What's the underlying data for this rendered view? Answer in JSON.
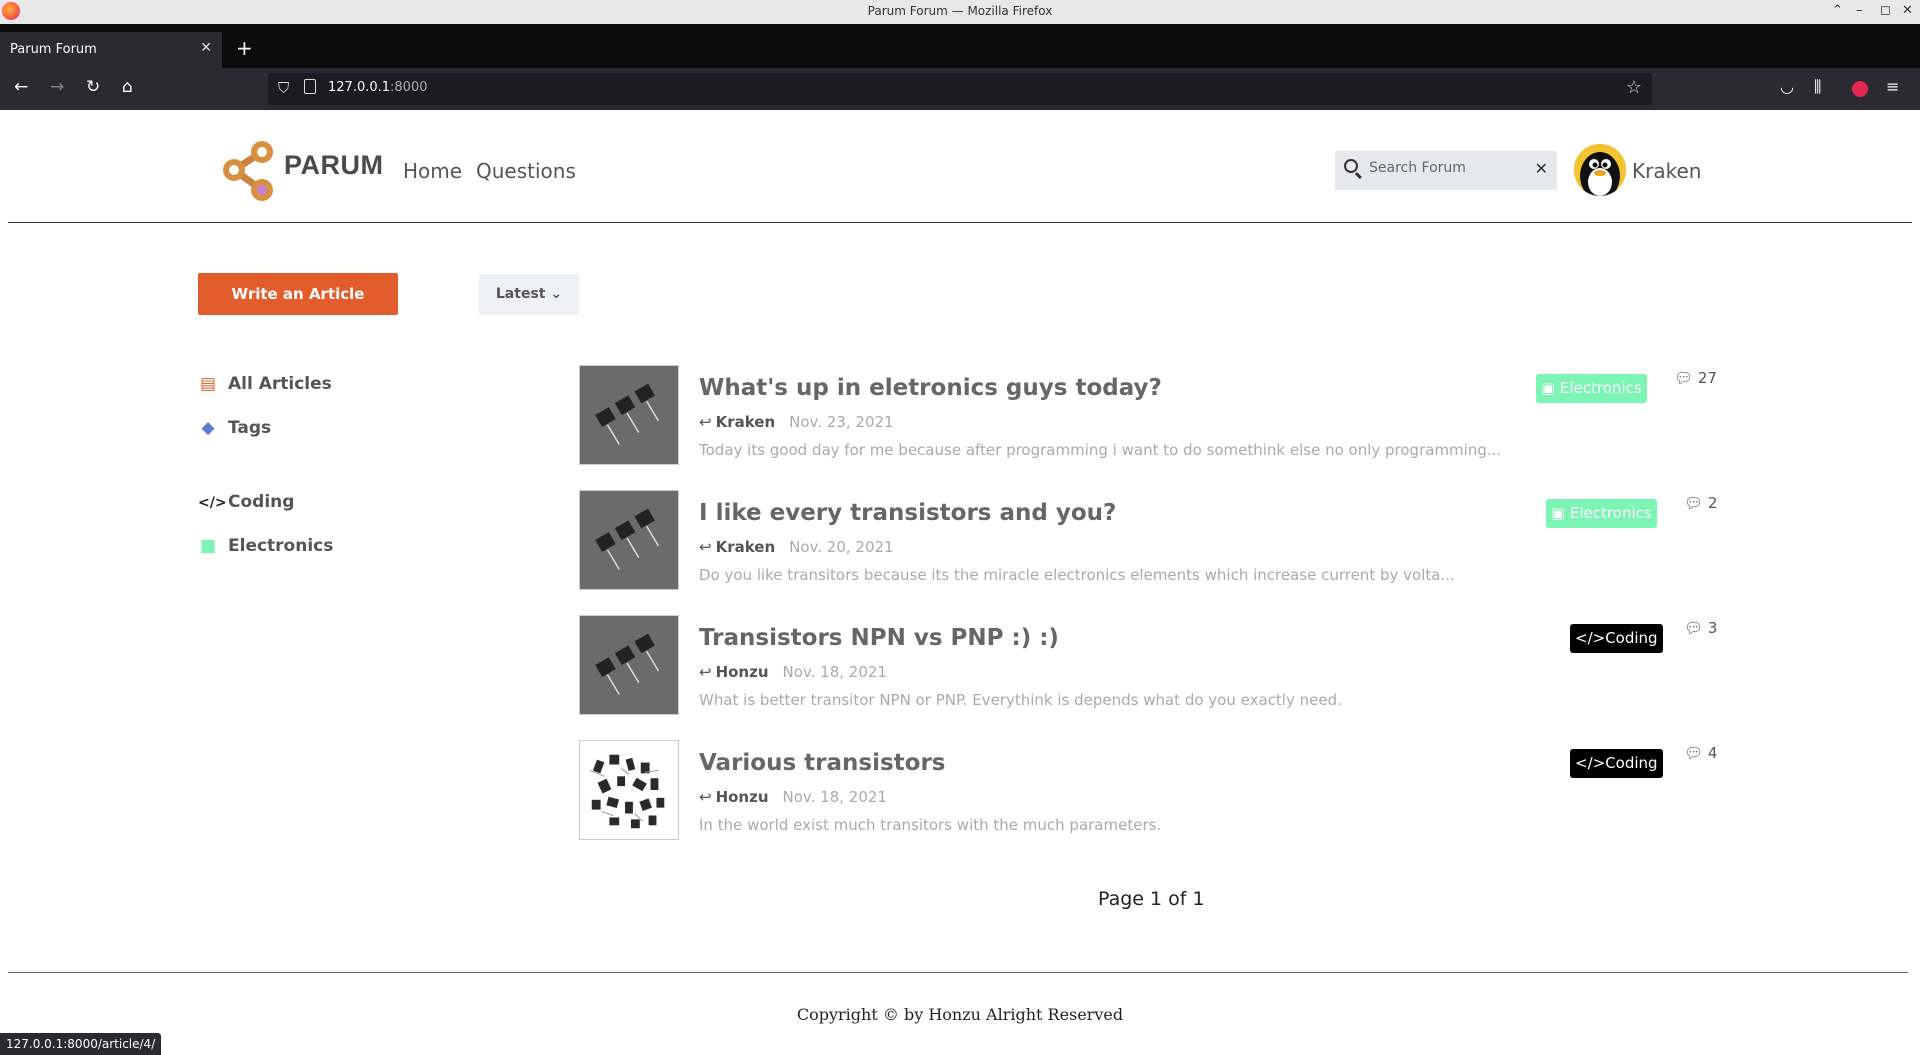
{
  "browser": {
    "window_title": "Parum Forum — Mozilla Firefox",
    "tab_title": "Parum Forum",
    "url_host": "127.0.0.1",
    "url_port": ":8000",
    "status_url": "127.0.0.1:8000/article/4/"
  },
  "header": {
    "logo_text": "PARUM",
    "nav": [
      "Home",
      "Questions"
    ],
    "search_placeholder": "Search Forum",
    "username": "Kraken"
  },
  "toolbar": {
    "write_label": "Write an Article",
    "sort_label": "Latest"
  },
  "sidebar": {
    "items": [
      {
        "label": "All Articles",
        "icon": "articles-icon"
      },
      {
        "label": "Tags",
        "icon": "tag-icon"
      },
      {
        "label": "Coding",
        "icon": "code-icon"
      },
      {
        "label": "Electronics",
        "icon": "robot-icon"
      }
    ]
  },
  "articles": [
    {
      "title": "What's up in eletronics guys today?",
      "author": "Kraken",
      "date": "Nov. 23, 2021",
      "excerpt": "Today its good day for me because after programming i want to do somethink else no only programming...",
      "tag": "Electronics",
      "comments": "27"
    },
    {
      "title": "I like every transistors and you?",
      "author": "Kraken",
      "date": "Nov. 20, 2021",
      "excerpt": "Do you like transitors because its the miracle electronics elements which increase current by volta...",
      "tag": "Electronics",
      "comments": "2"
    },
    {
      "title": "Transistors NPN vs PNP :) :)",
      "author": "Honzu",
      "date": "Nov. 18, 2021",
      "excerpt": "What is better transitor NPN or PNP. Everythink is depends what do you exactly need.",
      "tag": "Coding",
      "comments": "3"
    },
    {
      "title": "Various transistors",
      "author": "Honzu",
      "date": "Nov. 18, 2021",
      "excerpt": "In the world exist much transitors with the much parameters.",
      "tag": "Coding",
      "comments": "4"
    }
  ],
  "pagination": {
    "label": "Page 1 of 1"
  },
  "footer": {
    "copyright": "Copyright © by Honzu Alright Reserved"
  },
  "colors": {
    "accent": "#e25d2b",
    "electronics_tag": "#7cf5b4",
    "coding_tag": "#000000"
  }
}
